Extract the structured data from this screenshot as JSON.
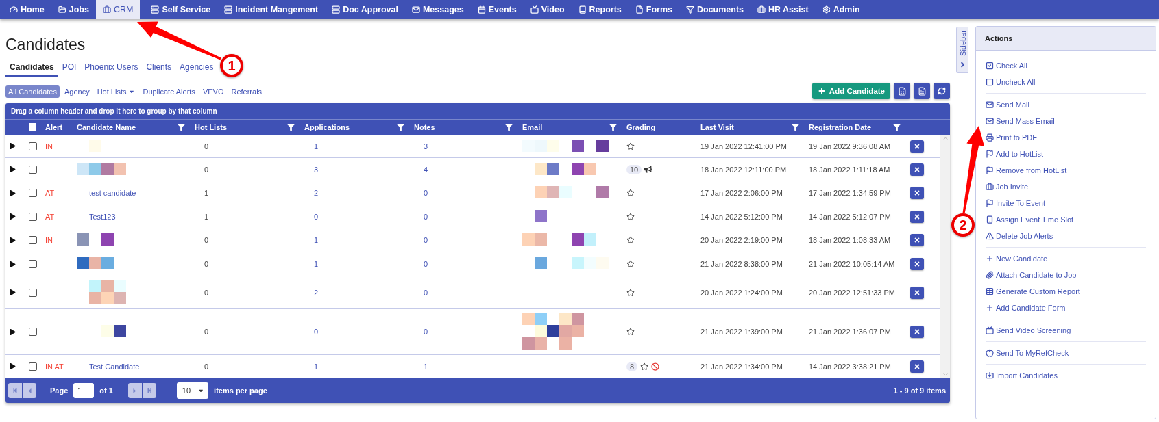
{
  "nav": {
    "items": [
      {
        "label": "Home",
        "selected": false
      },
      {
        "label": "Jobs",
        "selected": false
      },
      {
        "label": "CRM",
        "selected": true
      },
      {
        "label": "Self Service",
        "selected": false
      },
      {
        "label": "Incident Mangement",
        "selected": false
      },
      {
        "label": "Doc Approval",
        "selected": false
      },
      {
        "label": "Messages",
        "selected": false
      },
      {
        "label": "Events",
        "selected": false
      },
      {
        "label": "Video",
        "selected": false
      },
      {
        "label": "Reports",
        "selected": false
      },
      {
        "label": "Forms",
        "selected": false
      },
      {
        "label": "Documents",
        "selected": false
      },
      {
        "label": "HR Assist",
        "selected": false
      },
      {
        "label": "Admin",
        "selected": false
      }
    ]
  },
  "page_title": "Candidates",
  "tabs": [
    {
      "label": "Candidates",
      "selected": true
    },
    {
      "label": "POI",
      "selected": false
    },
    {
      "label": "Phoenix Users",
      "selected": false
    },
    {
      "label": "Clients",
      "selected": false
    },
    {
      "label": "Agencies",
      "selected": false
    }
  ],
  "subtabs": [
    {
      "label": "All Candidates",
      "selected": true,
      "dropdown": false
    },
    {
      "label": "Agency",
      "selected": false,
      "dropdown": false
    },
    {
      "label": "Hot Lists",
      "selected": false,
      "dropdown": true
    },
    {
      "label": "Duplicate Alerts",
      "selected": false,
      "dropdown": false
    },
    {
      "label": "VEVO",
      "selected": false,
      "dropdown": false
    },
    {
      "label": "Referrals",
      "selected": false,
      "dropdown": false
    }
  ],
  "add_button": "Add Candidate",
  "table": {
    "group_hint": "Drag a column header and drop it here to group by that column",
    "select_all_checked": false,
    "columns": [
      {
        "label": "Alert",
        "filterable": false
      },
      {
        "label": "Candidate Name",
        "filterable": true
      },
      {
        "label": "Hot Lists",
        "filterable": true
      },
      {
        "label": "Applications",
        "filterable": true
      },
      {
        "label": "Notes",
        "filterable": true
      },
      {
        "label": "Email",
        "filterable": true
      },
      {
        "label": "Grading",
        "filterable": false
      },
      {
        "label": "Last Visit",
        "filterable": true
      },
      {
        "label": "Registration Date",
        "filterable": true
      }
    ],
    "rows": [
      {
        "checked": false,
        "alert": "IN",
        "name": {
          "kind": "redacted"
        },
        "hot_lists": "0",
        "applications": "1",
        "notes": "3",
        "email_redacted": true,
        "grading": {
          "star": true
        },
        "last_visit": "19 Jan 2022 12:41:00 PM",
        "registration_date": "19 Jan 2022 9:36:08 AM"
      },
      {
        "checked": false,
        "name": {
          "kind": "redacted"
        },
        "hot_lists": "0",
        "applications": "3",
        "notes": "4",
        "email_redacted": true,
        "grading": {
          "count": "10",
          "star": false,
          "megaphone": true
        },
        "last_visit": "18 Jan 2022 12:11:00 PM",
        "registration_date": "18 Jan 2022 1:11:18 AM"
      },
      {
        "checked": false,
        "alert": "AT",
        "name": {
          "kind": "text",
          "text": "test candidate"
        },
        "hot_lists": "1",
        "applications": "2",
        "notes": "0",
        "email_redacted": true,
        "grading": {
          "star": true
        },
        "last_visit": "17 Jan 2022 2:06:00 PM",
        "registration_date": "17 Jan 2022 1:34:59 PM"
      },
      {
        "checked": false,
        "alert": "AT",
        "name": {
          "kind": "text",
          "text": "Test123"
        },
        "hot_lists": "1",
        "applications": "0",
        "notes": "0",
        "email_redacted": true,
        "grading": {
          "star": true
        },
        "last_visit": "14 Jan 2022 5:12:00 PM",
        "registration_date": "14 Jan 2022 5:12:07 PM"
      },
      {
        "checked": false,
        "alert": "IN",
        "name": {
          "kind": "redacted"
        },
        "hot_lists": "0",
        "applications": "1",
        "notes": "0",
        "email_redacted": true,
        "grading": {
          "star": true
        },
        "last_visit": "20 Jan 2022 2:19:00 PM",
        "registration_date": "18 Jan 2022 1:08:33 AM"
      },
      {
        "checked": false,
        "name": {
          "kind": "redacted"
        },
        "hot_lists": "0",
        "applications": "1",
        "notes": "0",
        "email_redacted": true,
        "grading": {
          "star": true
        },
        "last_visit": "21 Jan 2022 8:38:00 PM",
        "registration_date": "21 Jan 2022 10:05:14 AM"
      },
      {
        "checked": false,
        "name": {
          "kind": "redacted"
        },
        "hot_lists": "0",
        "applications": "2",
        "notes": "0",
        "email_redacted": false,
        "grading": {
          "star": true
        },
        "last_visit": "20 Jan 2022 1:24:00 PM",
        "registration_date": "20 Jan 2022 12:51:33 PM"
      },
      {
        "checked": false,
        "name": {
          "kind": "redacted"
        },
        "hot_lists": "0",
        "applications": "0",
        "notes": "0",
        "email_redacted": true,
        "grading": {
          "star": true
        },
        "last_visit": "21 Jan 2022 1:39:00 PM",
        "registration_date": "21 Jan 2022 1:36:07 PM"
      },
      {
        "checked": false,
        "alert": "IN AT",
        "name": {
          "kind": "text",
          "text": "Test Candidate"
        },
        "hot_lists": "0",
        "applications": "1",
        "notes": "1",
        "email_redacted": false,
        "grading": {
          "count": "8",
          "star": true,
          "blocked": true
        },
        "last_visit": "21 Jan 2022 1:34:00 PM",
        "registration_date": "14 Jan 2022 3:38:21 PM"
      }
    ],
    "pager": {
      "buttons_disabled": true,
      "page_label": "Page",
      "page": "1",
      "of_label": "of 1",
      "page_size": "10",
      "page_size_label": "items per page",
      "summary": "1 - 9 of 9 items"
    }
  },
  "sidebar_tab": "Sidebar",
  "actions": {
    "title": "Actions",
    "groups": [
      [
        {
          "label": "Check All"
        },
        {
          "label": "Uncheck All"
        }
      ],
      [
        {
          "label": "Send Mail"
        },
        {
          "label": "Send Mass Email"
        },
        {
          "label": "Print to PDF"
        },
        {
          "label": "Add to HotList"
        },
        {
          "label": "Remove from HotList"
        },
        {
          "label": "Job Invite"
        },
        {
          "label": "Invite To Event"
        },
        {
          "label": "Assign Event Time Slot"
        },
        {
          "label": "Delete Job Alerts"
        }
      ],
      [
        {
          "label": "New Candidate"
        },
        {
          "label": "Attach Candidate to Job"
        },
        {
          "label": "Generate Custom Report"
        },
        {
          "label": "Add Candidate Form"
        }
      ],
      [
        {
          "label": "Send Video Screening"
        }
      ],
      [
        {
          "label": "Send To MyRefCheck"
        }
      ],
      [
        {
          "label": "Import Candidates"
        }
      ]
    ]
  },
  "annotations": [
    {
      "number": "1"
    },
    {
      "number": "2"
    }
  ]
}
